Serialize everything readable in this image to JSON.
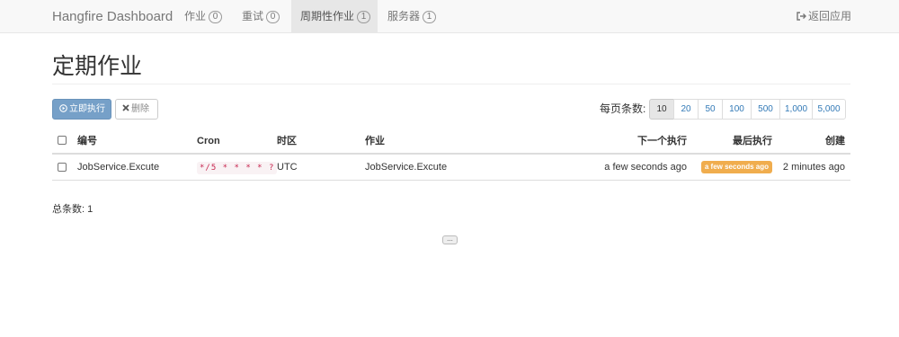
{
  "navbar": {
    "brand": "Hangfire Dashboard",
    "items": [
      {
        "label": "作业",
        "count": "0"
      },
      {
        "label": "重试",
        "count": "0"
      },
      {
        "label": "周期性作业",
        "count": "1"
      },
      {
        "label": "服务器",
        "count": "1"
      }
    ],
    "active_item": "周期性作业",
    "back_label": "返回应用",
    "back_icon": "sign-out-icon"
  },
  "page": {
    "title": "定期作业"
  },
  "actions": {
    "trigger_label": "立即执行",
    "trigger_icon": "play-circle-icon",
    "delete_label": "删除",
    "delete_icon": "x-icon"
  },
  "pager": {
    "label": "每页条数:",
    "options": [
      "10",
      "20",
      "50",
      "100",
      "500",
      "1,000",
      "5,000"
    ],
    "selected": "10"
  },
  "table": {
    "headers": {
      "id": "编号",
      "cron": "Cron",
      "timezone": "时区",
      "job": "作业",
      "next_execution": "下一个执行",
      "last_execution": "最后执行",
      "created": "创建"
    },
    "rows": [
      {
        "id": "JobService.Excute",
        "cron": "*/5 * * * * ?",
        "timezone": "UTC",
        "job": "JobService.Excute",
        "next_execution": "a few seconds ago",
        "last_execution": "a few seconds ago",
        "created": "2 minutes ago"
      }
    ]
  },
  "footer": {
    "total": "总条数: 1",
    "ellipsis": "..."
  },
  "colors": {
    "primary": "#76a0c8",
    "warning": "#f0ad4e",
    "link": "#337ab7",
    "code": "#c7254e"
  }
}
